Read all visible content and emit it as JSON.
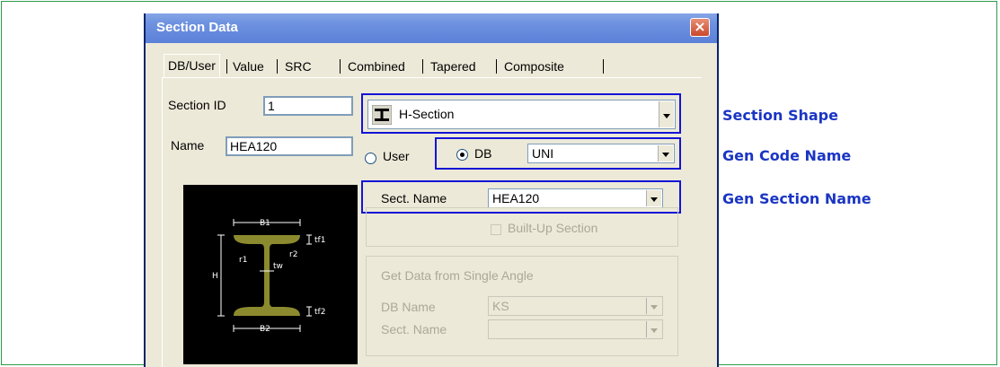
{
  "window": {
    "title": "Section Data",
    "close_glyph": "×"
  },
  "tabs": [
    "DB/User",
    "Value",
    "SRC",
    "Combined",
    "Tapered",
    "Composite"
  ],
  "section_id": {
    "label": "Section ID",
    "value": "1"
  },
  "name": {
    "label": "Name",
    "value": "HEA120"
  },
  "shape_combo": {
    "value": "H-Section",
    "icon": "h-section-icon"
  },
  "source": {
    "user_label": "User",
    "db_label": "DB",
    "selected": "DB",
    "db_value": "UNI"
  },
  "sect_name": {
    "label": "Sect. Name",
    "value": "HEA120"
  },
  "built_up": {
    "label": "Built-Up Section",
    "checked": false
  },
  "angle_group": {
    "title": "Get Data from Single Angle",
    "db_label": "DB Name",
    "db_value": "KS",
    "sect_label": "Sect. Name",
    "sect_value": ""
  },
  "diagram_labels": {
    "b1": "B1",
    "b2": "B2",
    "h": "H",
    "tf1": "tf1",
    "tf2": "tf2",
    "tw": "tw",
    "r1": "r1",
    "r2": "r2"
  },
  "callouts": {
    "shape": "Section Shape",
    "code": "Gen Code Name",
    "section": "Gen Section Name"
  },
  "colors": {
    "highlight": "#1414d6",
    "callout": "#1a35c4",
    "frame": "#2e9b4a",
    "section_fill": "#8c8a2e"
  }
}
